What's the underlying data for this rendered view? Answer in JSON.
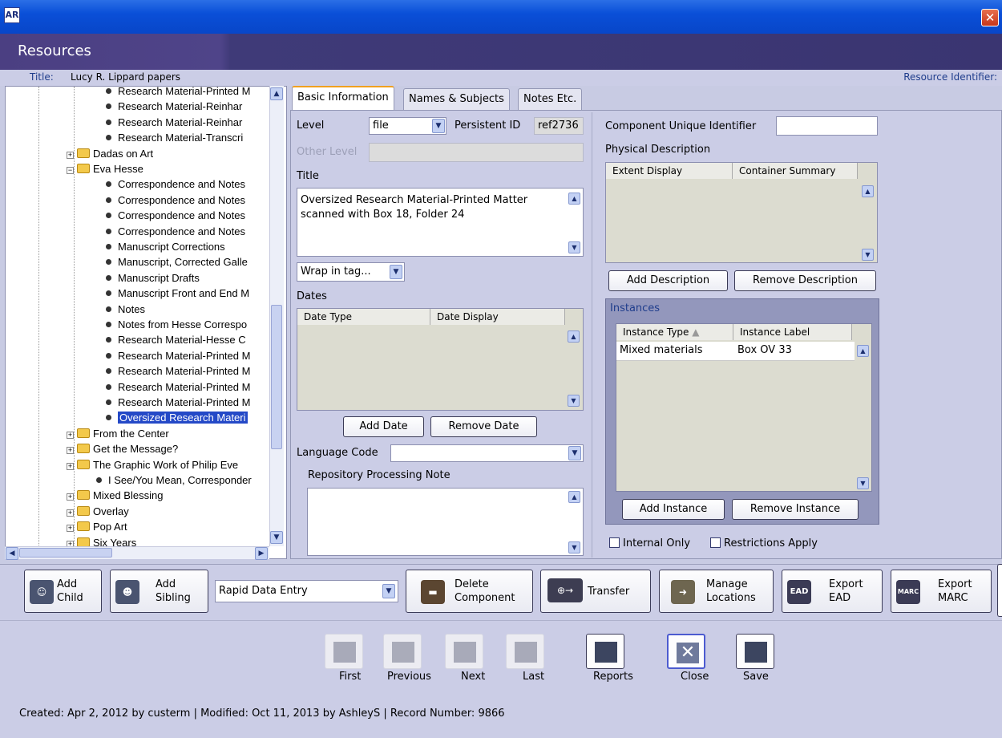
{
  "window": {
    "app_icon_text": "AR",
    "close_glyph": "✕"
  },
  "header": {
    "title": "Resources"
  },
  "record": {
    "title_label": "Title:",
    "title_value": "Lucy R. Lippard papers",
    "identifier_label": "Resource Identifier:"
  },
  "tree": {
    "rows": [
      {
        "label": "Research Material-Printed M",
        "type": "leaf"
      },
      {
        "label": "Research Material-Reinhar",
        "type": "leaf"
      },
      {
        "label": "Research Material-Reinhar",
        "type": "leaf"
      },
      {
        "label": "Research Material-Transcri",
        "type": "leaf"
      },
      {
        "label": "Dadas on Art",
        "type": "folder"
      },
      {
        "label": "Eva Hesse",
        "type": "folder-open"
      },
      {
        "label": "Correspondence and Notes",
        "type": "leaf"
      },
      {
        "label": "Correspondence and Notes",
        "type": "leaf"
      },
      {
        "label": "Correspondence and Notes",
        "type": "leaf"
      },
      {
        "label": "Correspondence and Notes",
        "type": "leaf"
      },
      {
        "label": "Manuscript Corrections",
        "type": "leaf"
      },
      {
        "label": "Manuscript, Corrected Galle",
        "type": "leaf"
      },
      {
        "label": "Manuscript Drafts",
        "type": "leaf"
      },
      {
        "label": "Manuscript Front and End M",
        "type": "leaf"
      },
      {
        "label": "Notes",
        "type": "leaf"
      },
      {
        "label": "Notes from Hesse Correspo",
        "type": "leaf"
      },
      {
        "label": "Research Material-Hesse C",
        "type": "leaf"
      },
      {
        "label": "Research Material-Printed M",
        "type": "leaf"
      },
      {
        "label": "Research Material-Printed M",
        "type": "leaf"
      },
      {
        "label": "Research Material-Printed M",
        "type": "leaf"
      },
      {
        "label": "Research Material-Printed M",
        "type": "leaf"
      },
      {
        "label": "Oversized Research Materi",
        "type": "leaf",
        "selected": true
      },
      {
        "label": "From the Center",
        "type": "folder"
      },
      {
        "label": "Get the Message?",
        "type": "folder"
      },
      {
        "label": "The Graphic Work of Philip Eve",
        "type": "folder"
      },
      {
        "label": "I See/You Mean, Corresponder",
        "type": "leaf-top"
      },
      {
        "label": "Mixed Blessing",
        "type": "folder"
      },
      {
        "label": "Overlay",
        "type": "folder"
      },
      {
        "label": "Pop Art",
        "type": "folder"
      },
      {
        "label": "Six Years",
        "type": "folder"
      }
    ]
  },
  "tabs": [
    {
      "label": "Basic Information",
      "active": true
    },
    {
      "label": "Names & Subjects",
      "active": false
    },
    {
      "label": "Notes Etc.",
      "active": false
    }
  ],
  "basic": {
    "level_label": "Level",
    "level_value": "file",
    "persistent_id_label": "Persistent ID",
    "persistent_id_value": "ref2736",
    "other_level_label": "Other Level",
    "title_label": "Title",
    "title_value": "Oversized Research Material-Printed Matter scanned with Box 18, Folder 24",
    "wrap_tag": "Wrap in tag...",
    "dates_label": "Dates",
    "dates_columns": [
      "Date Type",
      "Date Display"
    ],
    "add_date": "Add Date",
    "remove_date": "Remove Date",
    "language_code_label": "Language Code",
    "repo_note_label": "Repository Processing Note"
  },
  "right": {
    "cuid_label": "Component Unique Identifier",
    "phys_desc_label": "Physical Description",
    "phys_columns": [
      "Extent Display",
      "Container Summary"
    ],
    "add_description": "Add Description",
    "remove_description": "Remove Description",
    "instances_label": "Instances",
    "instance_columns": [
      "Instance Type",
      "Instance Label"
    ],
    "instance_rows": [
      {
        "type": "Mixed materials",
        "label": "Box OV 33"
      }
    ],
    "add_instance": "Add Instance",
    "remove_instance": "Remove Instance",
    "internal_only": "Internal Only",
    "restrictions_apply": "Restrictions Apply"
  },
  "toolbar": {
    "add_child": [
      "Add",
      "Child"
    ],
    "add_sibling": [
      "Add",
      "Sibling"
    ],
    "rapid_entry": "Rapid Data Entry",
    "delete_component": [
      "Delete",
      "Component"
    ],
    "transfer": "Transfer",
    "manage_locations": [
      "Manage",
      "Locations"
    ],
    "export_ead": [
      "Export",
      "EAD"
    ],
    "export_marc": [
      "Export",
      "MARC"
    ]
  },
  "nav": {
    "first": "First",
    "previous": "Previous",
    "next": "Next",
    "last": "Last",
    "reports": "Reports",
    "close": "Close",
    "save": "Save"
  },
  "status": "Created: Apr 2, 2012 by custerm | Modified: Oct 11, 2013 by AshleyS | Record Number: 9866",
  "colors": {
    "header": "#4b3f82",
    "selection": "#2449c7",
    "panel": "#cbcde6"
  }
}
